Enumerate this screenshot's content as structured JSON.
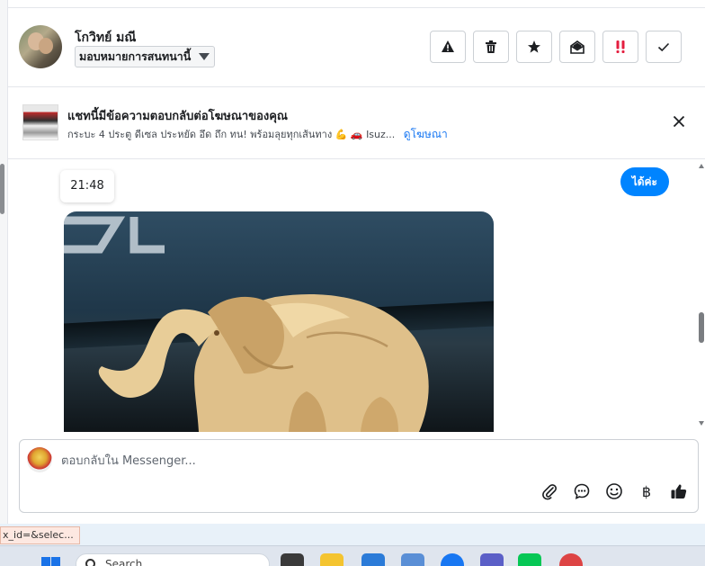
{
  "header": {
    "user_name": "โกวิทย์ มณี",
    "assign_label": "มอบหมายการสนทนานี้",
    "actions": [
      "alert-icon",
      "trash-icon",
      "star-icon",
      "envelope-open-icon",
      "urgent-icon",
      "check-icon"
    ]
  },
  "ad": {
    "title": "แชทนี้มีข้อความตอบกลับต่อโฆษณาของคุณ",
    "subtitle": "กระบะ 4 ประตู ดีเซล ประหยัด อึด ถึก ทน! พร้อมลุยทุกเส้นทาง 💪 🚗 Isuz...",
    "link": "ดูโฆษณา"
  },
  "chat": {
    "timestamp": "21:48",
    "outgoing_message": "ได้ค่ะ"
  },
  "composer": {
    "placeholder": "ตอบกลับใน Messenger...",
    "tools": [
      "paperclip-icon",
      "chat-bubble-icon",
      "emoji-icon",
      "baht-icon",
      "like-icon"
    ],
    "baht_symbol": "฿"
  },
  "statusbar": {
    "url_fragment": "x_id=&selec..."
  },
  "taskbar": {
    "search_placeholder": "Search"
  },
  "colors": {
    "messenger_blue": "#0084ff",
    "link_blue": "#1877f2",
    "urgent_red": "#e41e3f"
  }
}
